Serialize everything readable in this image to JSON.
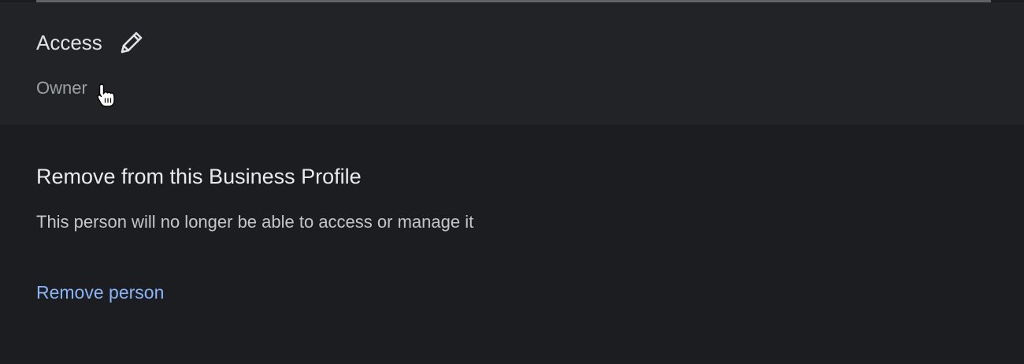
{
  "access": {
    "title": "Access",
    "value": "Owner",
    "edit_icon": "pencil-icon"
  },
  "remove": {
    "title": "Remove from this Business Profile",
    "description": "This person will no longer be able to access or manage it",
    "link_label": "Remove person"
  },
  "colors": {
    "background": "#1c1d20",
    "access_panel": "#222326",
    "link": "#8ab4f8",
    "muted_text": "#9aa0a6"
  }
}
